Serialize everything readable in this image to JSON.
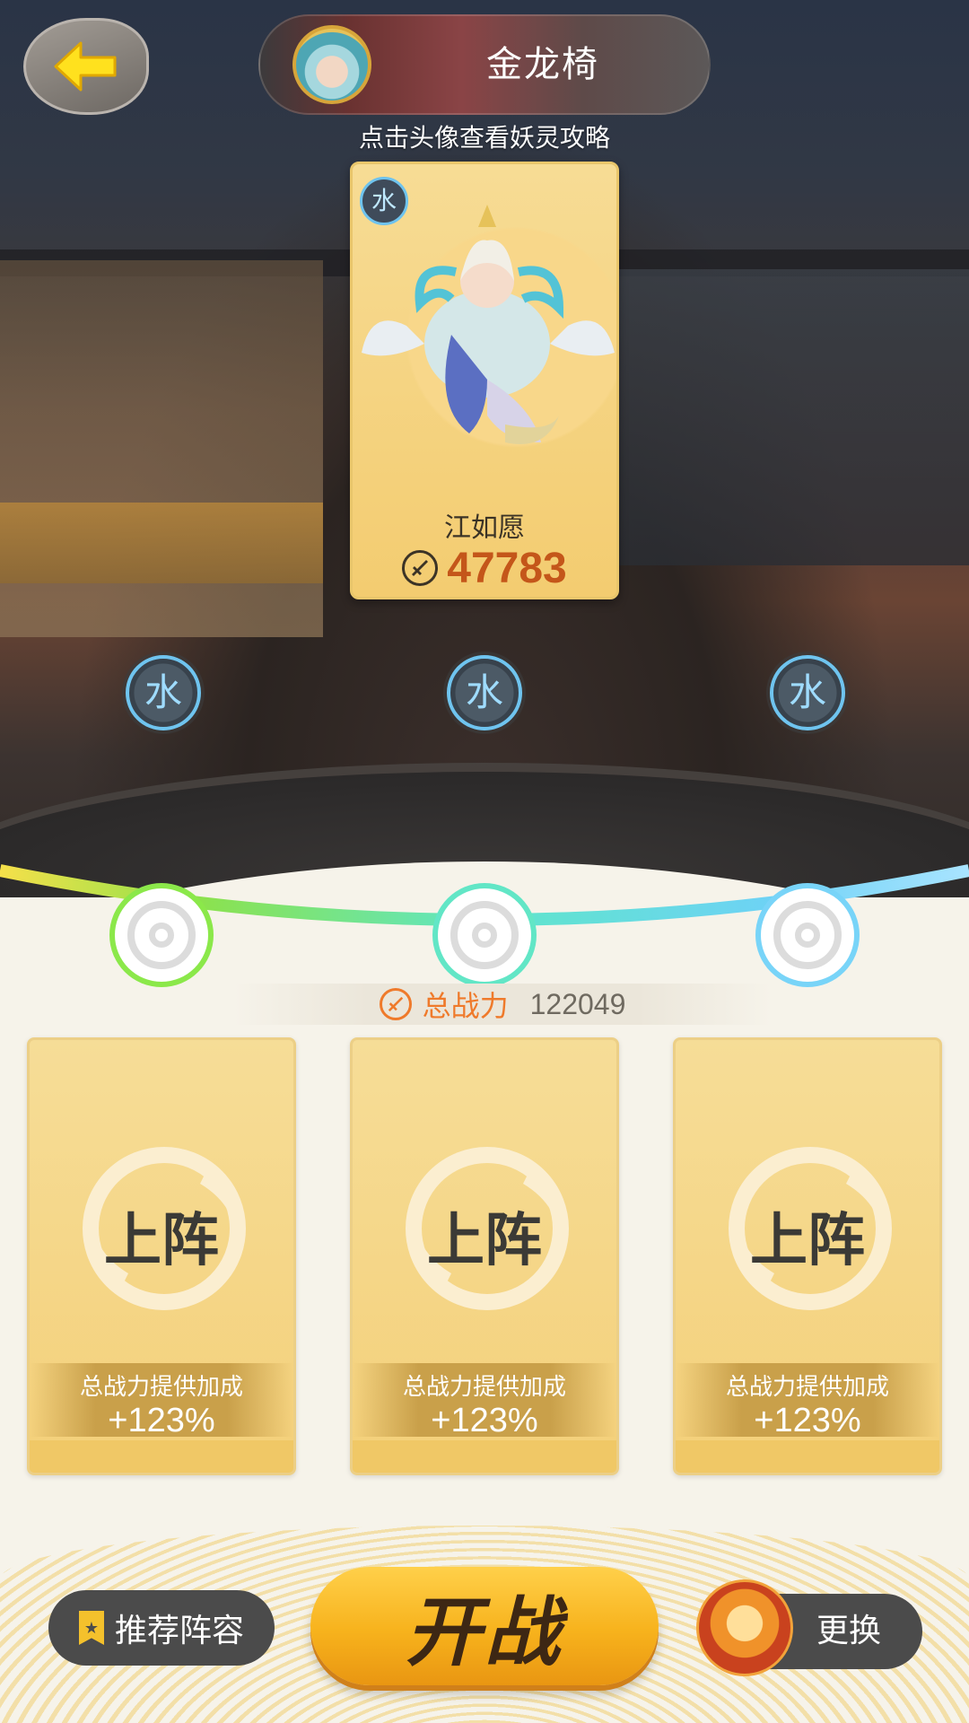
{
  "header": {
    "back_icon": "back-arrow-icon",
    "title": "金龙椅",
    "hint": "点击头像查看妖灵攻略"
  },
  "selected_spirit": {
    "element": "水",
    "name": "江如愿",
    "power": "47783"
  },
  "slot_elements": [
    "水",
    "水",
    "水"
  ],
  "total_power": {
    "label": "总战力",
    "value": "122049"
  },
  "deploy_cards": [
    {
      "label": "上阵",
      "bonus_label": "总战力提供加成",
      "bonus_value": "+123%"
    },
    {
      "label": "上阵",
      "bonus_label": "总战力提供加成",
      "bonus_value": "+123%"
    },
    {
      "label": "上阵",
      "bonus_label": "总战力提供加成",
      "bonus_value": "+123%"
    }
  ],
  "footer": {
    "recommend_label": "推荐阵容",
    "fight_label": "开战",
    "swap_label": "更换"
  },
  "colors": {
    "accent_orange": "#ef7a2b",
    "power_orange": "#c4561a",
    "card_gold": "#f4d07a",
    "water_blue": "#6ec3ee",
    "button_dark": "#4b4b4b"
  }
}
